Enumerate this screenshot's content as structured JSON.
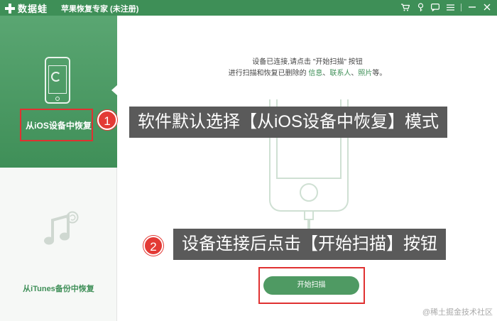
{
  "titlebar": {
    "logo_text": "数据蛙",
    "app_title": "苹果恢复专家 (未注册)"
  },
  "sidebar": {
    "items": [
      {
        "label": "从iOS设备中恢复",
        "active": true,
        "icon": "phone-sync-icon"
      },
      {
        "label": "从iTunes备份中恢复",
        "active": false,
        "icon": "music-sync-icon"
      }
    ]
  },
  "main": {
    "instruction_line1": "设备已连接,请点击 \"开始扫描\" 按钮",
    "instruction_line2_prefix": "进行扫描和恢复已删除的 ",
    "link_info": "信息",
    "sep1": "、",
    "link_contacts": "联系人",
    "sep2": "、",
    "link_photos": "照片",
    "instruction_line2_suffix": "等。",
    "device_label": "iPhone",
    "start_button": "开始扫描"
  },
  "annotations": [
    {
      "number": "1",
      "text": "软件默认选择【从iOS设备中恢复】模式"
    },
    {
      "number": "2",
      "text": "设备连接后点击【开始扫描】按钮"
    }
  ],
  "watermark": "@稀土掘金技术社区",
  "colors": {
    "brand_green": "#3e8f57",
    "highlight_red": "#e03131",
    "callout_bg": "#5a5a5a"
  }
}
